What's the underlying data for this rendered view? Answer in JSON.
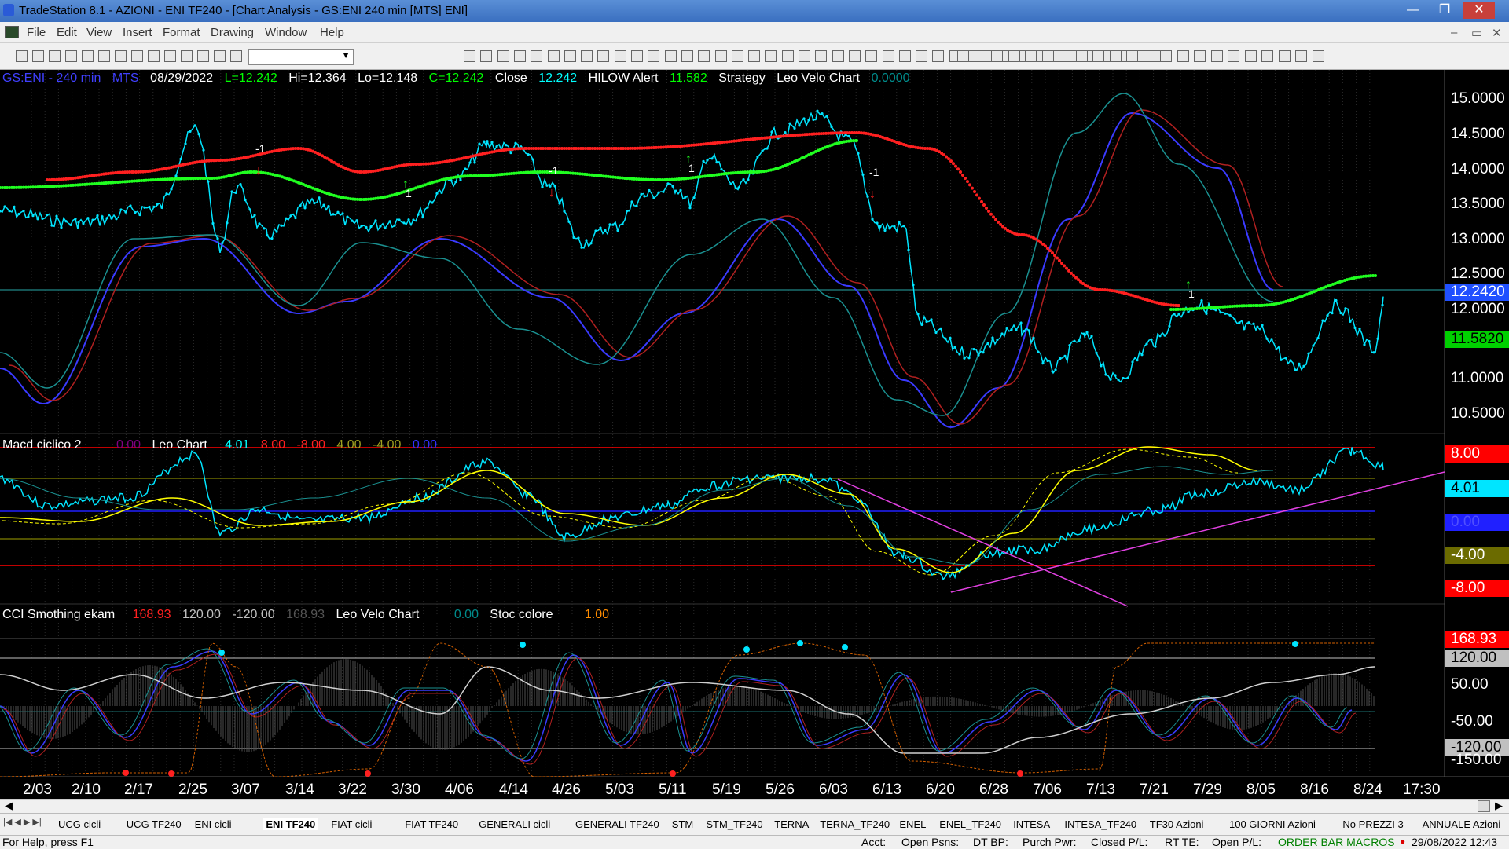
{
  "window": {
    "title": "TradeStation 8.1 - AZIONI - ENI TF240 - [Chart Analysis - GS:ENI  240 min  [MTS] ENI]"
  },
  "menu": [
    "File",
    "Edit",
    "View",
    "Insert",
    "Format",
    "Drawing",
    "Window",
    "Help"
  ],
  "toolbar": {
    "combo_value": ""
  },
  "price_header": {
    "symbol": "GS:ENI - 240 min",
    "mts": "MTS",
    "date": "08/29/2022",
    "l": "L=12.242",
    "hi": "Hi=12.364",
    "lo": "Lo=12.148",
    "c": "C=12.242",
    "close_label": "Close",
    "close_val": "12.242",
    "hilow_label": "HILOW Alert",
    "hilow_val": "11.582",
    "strategy": "Strategy",
    "leo": "Leo Velo Chart",
    "leo_val": "0.0000"
  },
  "macd_header": {
    "name": "Macd ciclico 2",
    "v1": "0.00",
    "leo": "Leo Chart",
    "v2": "4.01",
    "v3": "8.00",
    "v4": "-8.00",
    "v5": "4.00",
    "v6": "-4.00",
    "v7": "0.00"
  },
  "cci_header": {
    "name": "CCI Smothing ekam",
    "v1": "168.93",
    "v2": "120.00",
    "v3": "-120.00",
    "v4": "168.93",
    "leo": "Leo Velo Chart",
    "v5": "0.00",
    "stoc": "Stoc colore",
    "v6": "1.00"
  },
  "price_axis": [
    "15.0000",
    "14.5000",
    "14.0000",
    "13.5000",
    "13.0000",
    "12.5000",
    "12.0000",
    "11.5000",
    "11.0000",
    "10.5000"
  ],
  "price_tags": {
    "last": "12.2420",
    "alert": "11.5820"
  },
  "macd_axis": {
    "p8": "8.00",
    "v401": "4.01",
    "z": "0.00",
    "m4": "-4.00",
    "m8": "-8.00"
  },
  "cci_axis": {
    "v168": "168.93",
    "v120": "120.00",
    "v50": "50.00",
    "m50": "-50.00",
    "m120": "-120.00",
    "m150": "-150.00"
  },
  "x_axis": [
    "2/03",
    "2/10",
    "2/17",
    "2/25",
    "3/07",
    "3/14",
    "3/22",
    "3/30",
    "4/06",
    "4/14",
    "4/26",
    "5/03",
    "5/11",
    "5/19",
    "5/26",
    "6/03",
    "6/13",
    "6/20",
    "6/28",
    "7/06",
    "7/13",
    "7/21",
    "7/29",
    "8/05",
    "8/16",
    "8/24",
    "17:30"
  ],
  "tabs": [
    "UCG cicli",
    "UCG TF240",
    "ENI cicli",
    "ENI TF240",
    "FIAT cicli",
    "FIAT TF240",
    "GENERALI cicli",
    "GENERALI TF240",
    "STM",
    "STM_TF240",
    "TERNA",
    "TERNA_TF240",
    "ENEL",
    "ENEL_TF240",
    "INTESA",
    "INTESA_TF240",
    "TF30 Azioni",
    "100 GIORNI Azioni",
    "No PREZZI 3",
    "ANNUALE Azioni"
  ],
  "status": {
    "help": "For Help, press F1",
    "acct": "Acct:",
    "open_psns": "Open Psns:",
    "dt_bp": "DT BP:",
    "purch": "Purch Pwr:",
    "closed": "Closed P/L:",
    "rt": "RT TE:",
    "open_pl": "Open P/L:",
    "order": "ORDER BAR  MACROS",
    "datetime": "29/08/2022 12:43"
  },
  "signals": {
    "minus1": "-1",
    "one": "1"
  }
}
